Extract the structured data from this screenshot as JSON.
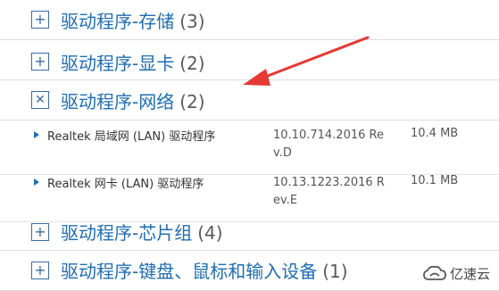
{
  "categories": [
    {
      "icon": "plus",
      "title": "驱动程序-存储",
      "count": "(3)"
    },
    {
      "icon": "plus",
      "title": "驱动程序-显卡",
      "count": "(2)"
    },
    {
      "icon": "close",
      "title": "驱动程序-网络",
      "count": "(2)"
    },
    {
      "icon": "plus",
      "title": "驱动程序-芯片组",
      "count": "(4)"
    },
    {
      "icon": "plus",
      "title": "驱动程序-键盘、鼠标和输入设备",
      "count": "(1)"
    }
  ],
  "drivers": [
    {
      "name": "Realtek 局域网 (LAN) 驱动程序",
      "version": "10.10.714.2016 Rev.D",
      "size": "10.4 MB"
    },
    {
      "name": "Realtek 网卡 (LAN) 驱动程序",
      "version": "10.13.1223.2016 Rev.E",
      "size": "10.1 MB"
    }
  ],
  "watermark": {
    "text": "亿速云"
  },
  "colors": {
    "accent": "#1f6db3",
    "arrow": "#e53935"
  }
}
